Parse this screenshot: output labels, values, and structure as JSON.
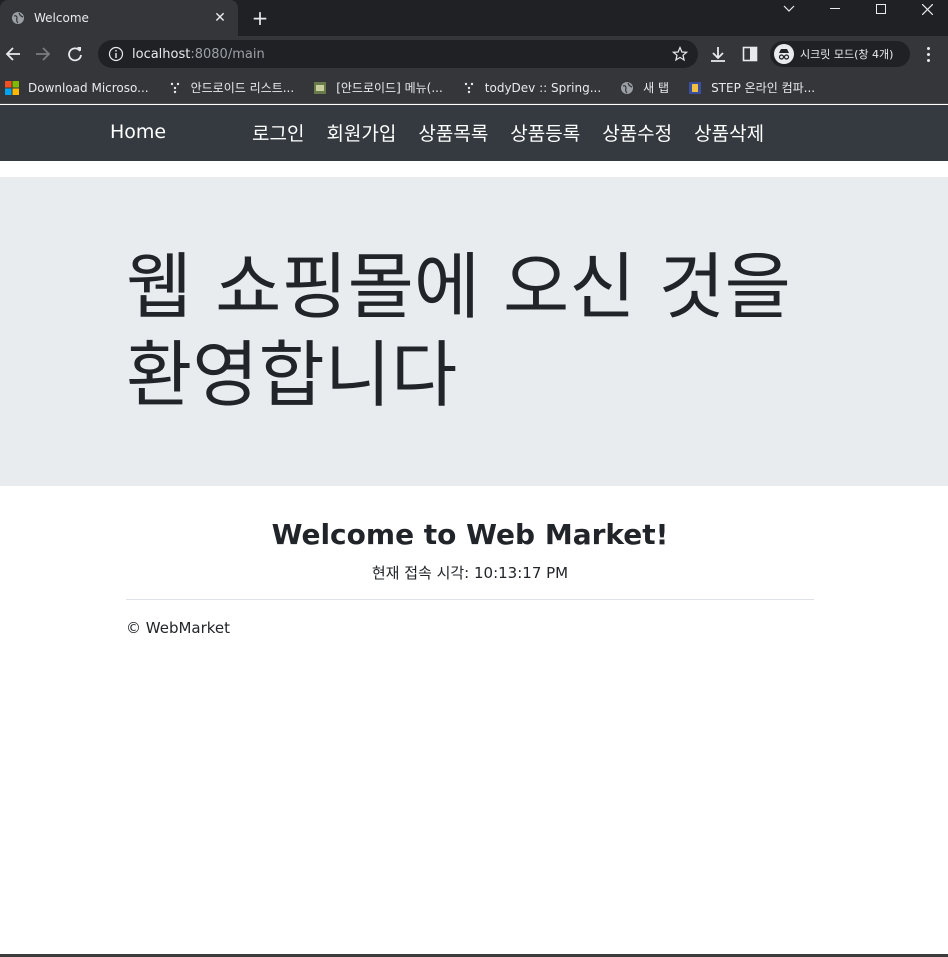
{
  "browser": {
    "tab_title": "Welcome",
    "url_host": "localhost",
    "url_path": ":8080/main",
    "incognito_label": "시크릿 모드(창 4개)",
    "bookmarks": [
      {
        "label": "Download Microso...",
        "icon": "windows-icon"
      },
      {
        "label": "안드로이드 리스트...",
        "icon": "dots-icon"
      },
      {
        "label": "[안드로이드] 메뉴(...",
        "icon": "image-icon"
      },
      {
        "label": "todyDev :: Spring...",
        "icon": "dots-icon"
      },
      {
        "label": "새 탭",
        "icon": "globe-icon"
      },
      {
        "label": "STEP 온라인 컴파...",
        "icon": "step-icon"
      }
    ]
  },
  "navbar": {
    "brand": "Home",
    "links": [
      "로그인",
      "회원가입",
      "상품목록",
      "상품등록",
      "상품수정",
      "상품삭제"
    ]
  },
  "jumbotron": {
    "greeting": "웹 쇼핑몰에 오신 것을 환영합니다"
  },
  "main": {
    "welcome": "Welcome to Web Market!",
    "clock_label": "현재 접속 시각: 10:13:17 PM"
  },
  "footer": {
    "text": "© WebMarket"
  },
  "colors": {
    "navbar_bg": "#343a40",
    "jumbotron_bg": "#e9ecef",
    "chrome_dark": "#202124",
    "chrome_toolbar": "#35363a"
  }
}
